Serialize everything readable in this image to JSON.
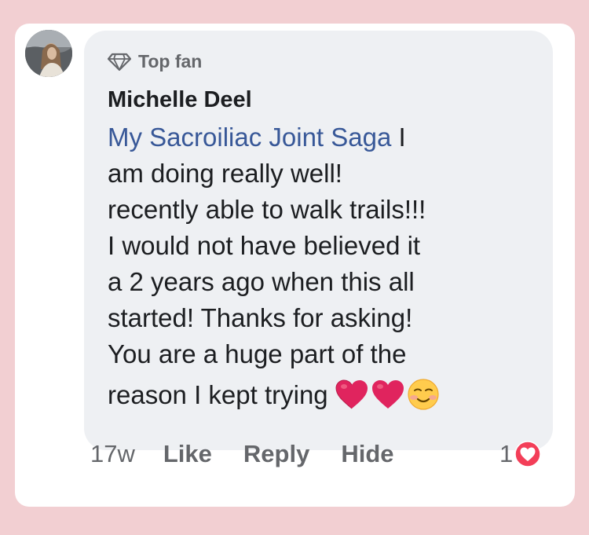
{
  "comment": {
    "badge": "Top fan",
    "badge_icon": "diamond-icon",
    "author": "Michelle Deel",
    "mention": "My Sacroiliac Joint Saga",
    "line1_rest": " I",
    "line2": "am doing really well!",
    "line3": "recently able to walk trails!!!",
    "line4": "I would not have believed it",
    "line5": "a 2 years ago when this all",
    "line6": "started! Thanks for asking!",
    "line7": "You are a huge part of the",
    "line8": "reason I kept trying",
    "emojis": [
      "red-heart-icon",
      "red-heart-icon",
      "smiling-face-icon"
    ]
  },
  "actions": {
    "time": "17w",
    "like": "Like",
    "reply": "Reply",
    "hide": "Hide"
  },
  "reactions": {
    "count": "1",
    "icon": "love-reaction-icon"
  },
  "colors": {
    "background": "#f2cfd2",
    "bubble": "#eef0f3",
    "link": "#385898",
    "secondary_text": "#65676b",
    "heart": "#e0245e"
  }
}
